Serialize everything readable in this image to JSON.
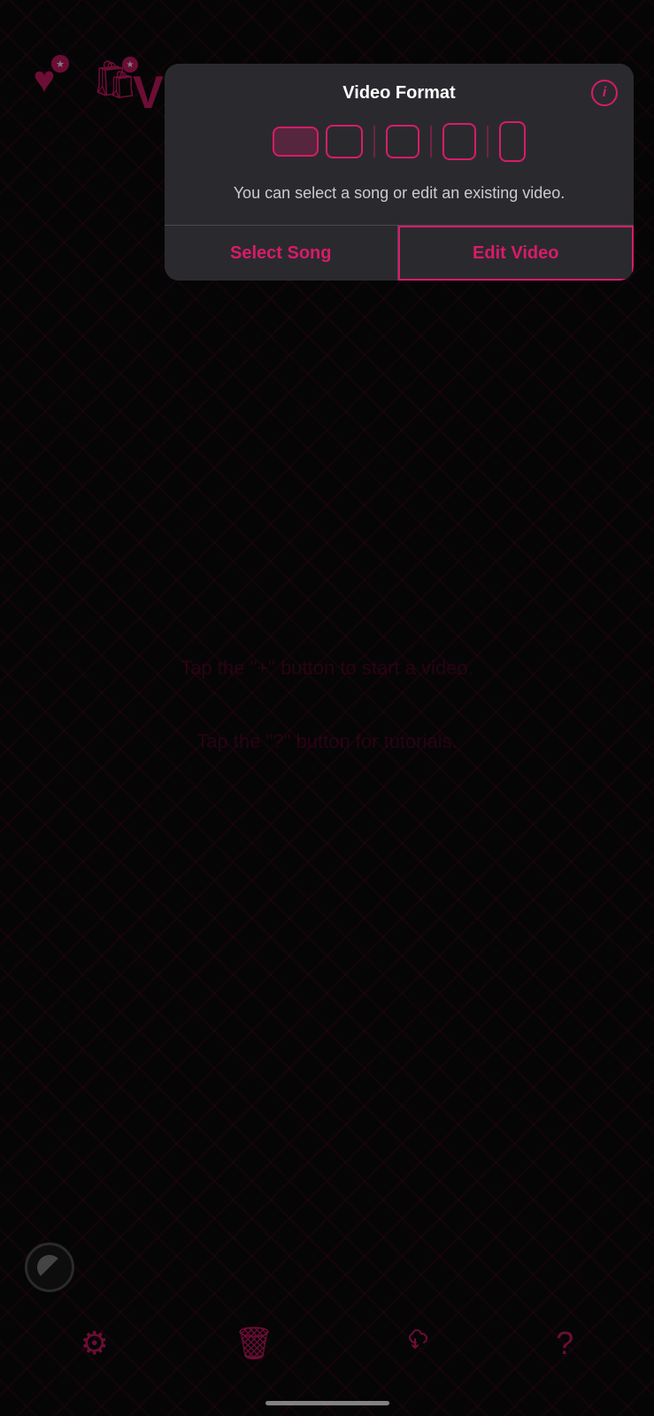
{
  "background": {
    "color": "#0a0a0a"
  },
  "top_left_letter": "V",
  "icons": {
    "heart_label": "❤",
    "bag_label": "🛍",
    "star_label": "★"
  },
  "hints": {
    "plus_hint": "Tap the \"+\" button to start a video.",
    "question_hint": "Tap the \"?\" button for tutorials."
  },
  "modal": {
    "title": "Video Format",
    "info_icon": "i",
    "description": "You can select a song or edit an existing video.",
    "formats": [
      {
        "id": "wide",
        "label": "wide",
        "active": true
      },
      {
        "id": "sq-wide",
        "label": "sq-wide",
        "active": false
      },
      {
        "id": "sq",
        "label": "square",
        "active": false
      },
      {
        "id": "sq-tall",
        "label": "sq-tall",
        "active": false
      },
      {
        "id": "tall",
        "label": "tall",
        "active": false
      }
    ],
    "select_song_label": "Select Song",
    "edit_video_label": "Edit Video"
  },
  "toolbar": {
    "settings_icon": "⚙",
    "trash_icon": "🗑",
    "download_icon": "⬇",
    "question_icon": "?"
  }
}
